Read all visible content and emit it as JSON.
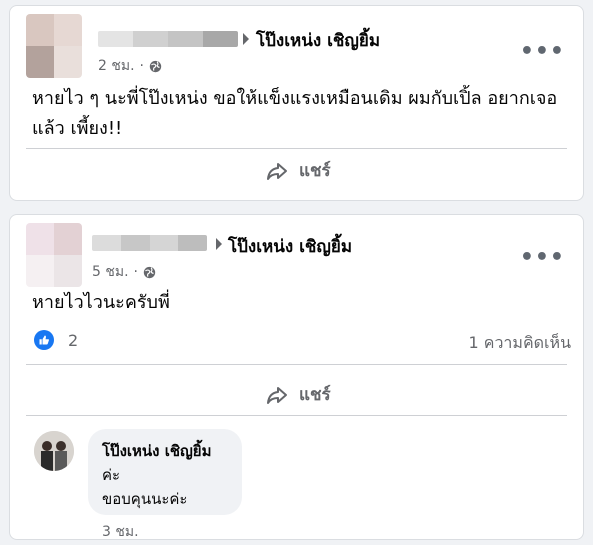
{
  "colors": {
    "background": "#f0f2f5",
    "card": "#ffffff",
    "secondary_text": "#65676b",
    "like_blue": "#1877f2",
    "divider": "#ced0d4"
  },
  "posts": [
    {
      "page_name": "โป๊งเหน่ง เชิญยิ้ม",
      "timestamp": "2 ชม.",
      "privacy_icon": "globe-icon",
      "body_lines": [
        "หายไว ๆ นะพี่โป๊งเหน่ง ขอให้แข็งแรงเหมือนเดิม ผมกับเปิ้ล อยากเจอ",
        "แล้ว เพี้ยง!!"
      ],
      "share_label": "แชร์"
    },
    {
      "page_name": "โป๊งเหน่ง เชิญยิ้ม",
      "timestamp": "5 ชม.",
      "privacy_icon": "globe-icon",
      "body_lines": [
        "หายไวไวนะครับพี่"
      ],
      "reaction_count": "2",
      "comment_count_label": "1 ความคิดเห็น",
      "share_label": "แชร์",
      "comment": {
        "author": "โป๊งเหน่ง เชิญยิ้ม",
        "lines": [
          "ค่ะ",
          "ขอบคุนนะค่ะ"
        ],
        "timestamp": "3 ชม."
      }
    }
  ]
}
